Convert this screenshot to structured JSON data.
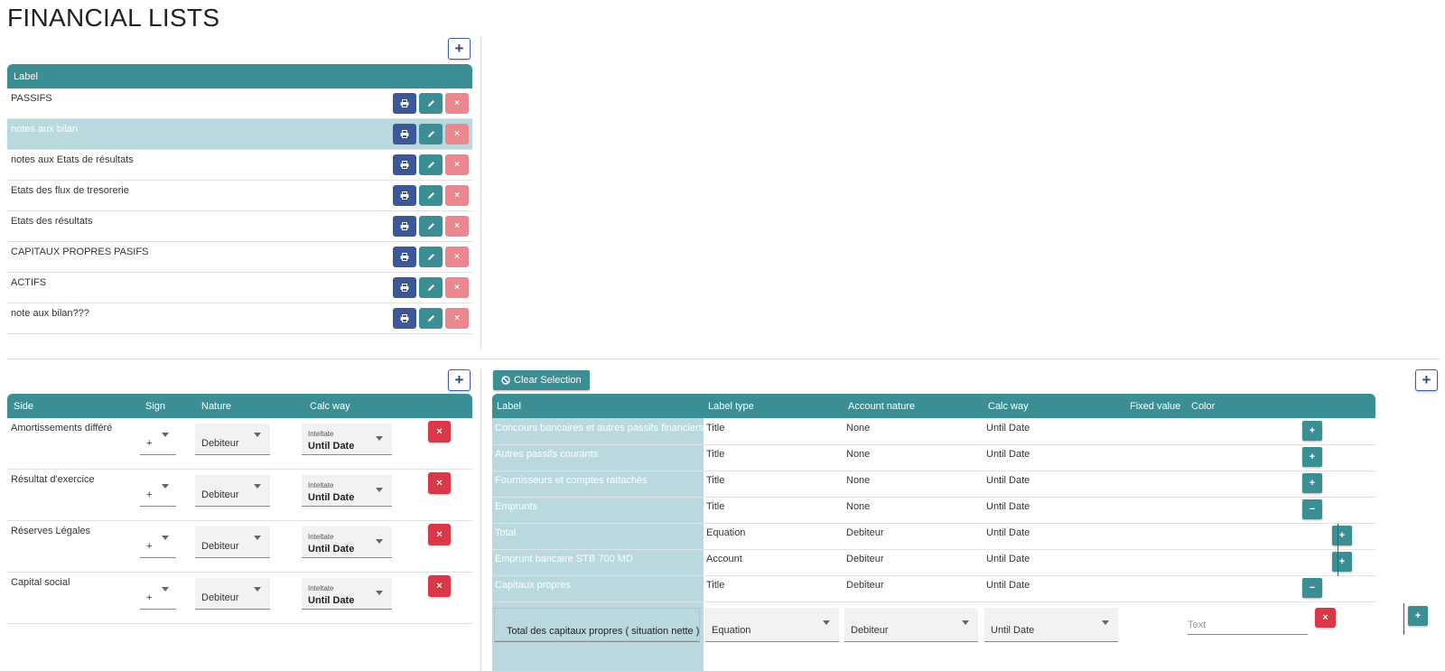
{
  "page_title": "FINANCIAL LISTS",
  "lists": {
    "header": "Label",
    "items": [
      {
        "label": "PASSIFS",
        "selected": false
      },
      {
        "label": "notes aux bilan",
        "selected": true
      },
      {
        "label": "notes aux Etats de résultats",
        "selected": false
      },
      {
        "label": "Etats des flux de tresorerie",
        "selected": false
      },
      {
        "label": "Etats des résultats",
        "selected": false
      },
      {
        "label": "CAPITAUX PROPRES PASIFS",
        "selected": false
      },
      {
        "label": "ACTIFS",
        "selected": false
      },
      {
        "label": "note aux bilan???",
        "selected": false
      }
    ]
  },
  "sides": {
    "headers": {
      "side": "Side",
      "sign": "Sign",
      "nature": "Nature",
      "calc_way": "Calc way"
    },
    "calc_small_label": "Inteltate",
    "rows": [
      {
        "side": "Amortissements différé",
        "sign": "+",
        "nature": "Debiteur",
        "calc_way": "Until Date"
      },
      {
        "side": "Résultat d'exercice",
        "sign": "+",
        "nature": "Debiteur",
        "calc_way": "Until Date"
      },
      {
        "side": "Réserves Légales",
        "sign": "+",
        "nature": "Debiteur",
        "calc_way": "Until Date"
      },
      {
        "side": "Capital social",
        "sign": "+",
        "nature": "Debiteur",
        "calc_way": "Until Date"
      }
    ]
  },
  "clear_selection_label": "Clear Selection",
  "items": {
    "headers": {
      "label": "Label",
      "label_type": "Label type",
      "account_nature": "Account nature",
      "calc_way": "Calc way",
      "fixed_value": "Fixed value",
      "color": "Color"
    },
    "rows": [
      {
        "label": "Concours bancaires et autres passifs financiers",
        "label_type": "Title",
        "account_nature": "None",
        "calc_way": "Until Date",
        "action": "+"
      },
      {
        "label": "Autres passifs courants",
        "label_type": "Title",
        "account_nature": "None",
        "calc_way": "Until Date",
        "action": "+"
      },
      {
        "label": "Fournisseurs et comptes rattachés",
        "label_type": "Title",
        "account_nature": "None",
        "calc_way": "Until Date",
        "action": "+"
      },
      {
        "label": "Emprunts",
        "label_type": "Title",
        "account_nature": "None",
        "calc_way": "Until Date",
        "action": "−"
      },
      {
        "label": "Total",
        "label_type": "Equation",
        "account_nature": "Debiteur",
        "calc_way": "Until Date",
        "action": "+"
      },
      {
        "label": "Emprunt bancaire STB 700 MD",
        "label_type": "Account",
        "account_nature": "Debiteur",
        "calc_way": "Until Date",
        "action": "+"
      },
      {
        "label": "Capitaux propres",
        "label_type": "Title",
        "account_nature": "Debiteur",
        "calc_way": "Until Date",
        "action": "−"
      }
    ],
    "edit_row": {
      "label": "Total des capitaux propres  ( situation nette )",
      "label_type": "Equation",
      "account_nature": "Debiteur",
      "calc_way": "Until Date",
      "color_placeholder": "Text"
    }
  },
  "icons": {
    "add": "+",
    "print": "print-icon",
    "edit": "pencil-icon",
    "delete": "×",
    "ban": "ban-icon"
  },
  "colors": {
    "teal": "#3b8f94",
    "navy": "#3c5898",
    "pink": "#ec8790",
    "red": "#d93848",
    "selection": "#b9d9de"
  }
}
